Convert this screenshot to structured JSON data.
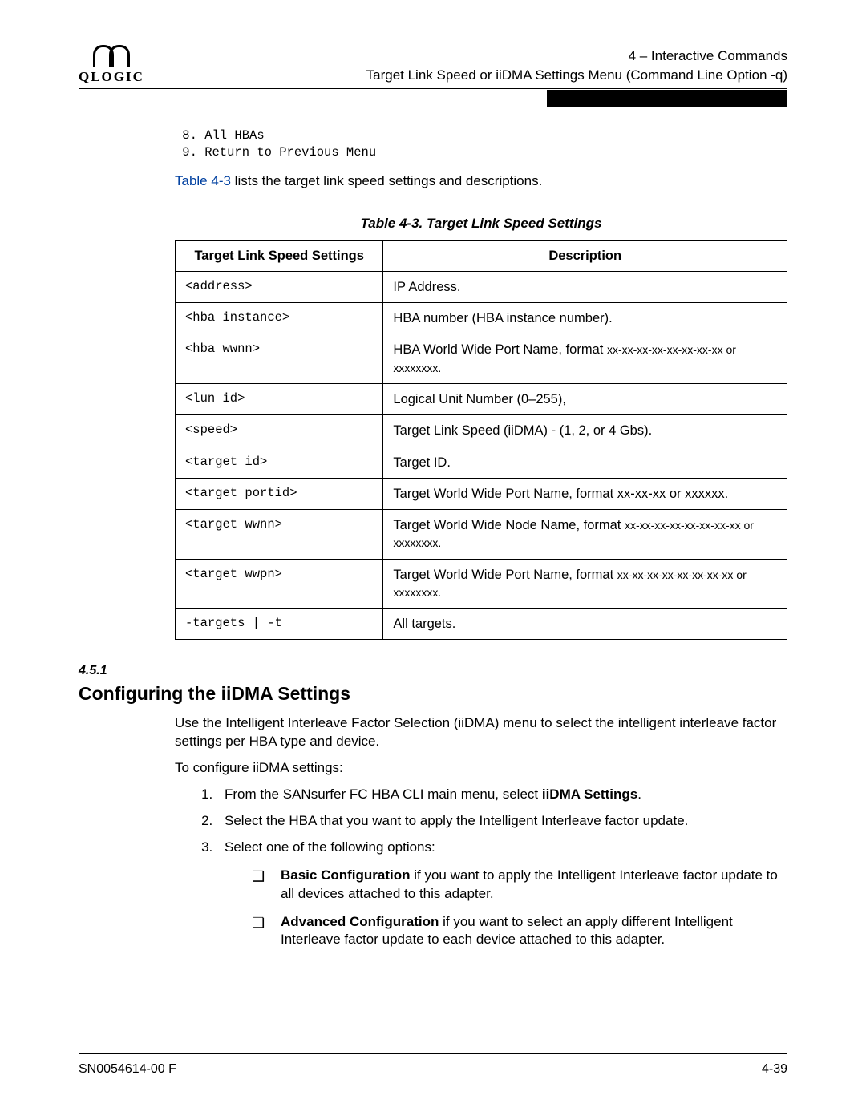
{
  "header": {
    "logo_text": "QLOGIC",
    "line1": "4 – Interactive Commands",
    "line2": "Target Link Speed or iiDMA Settings Menu (Command Line Option -q)"
  },
  "menu_lines": " 8. All HBAs\n 9. Return to Previous Menu",
  "intro_link": "Table 4-3",
  "intro_rest": " lists the target link speed settings and descriptions.",
  "table_title": "Table 4-3. Target Link Speed Settings",
  "table_headers": {
    "c1": "Target Link Speed Settings",
    "c2": "Description"
  },
  "rows": [
    {
      "c": "<address>",
      "d": "IP Address."
    },
    {
      "c": "<hba instance>",
      "d": "HBA number (HBA instance number)."
    },
    {
      "c": "<hba wwnn>",
      "d": "HBA World Wide Port Name, format ",
      "sub": "xx-xx-xx-xx-xx-xx-xx-xx or xxxxxxxx."
    },
    {
      "c": "<lun id>",
      "d": "Logical Unit Number (0–255),"
    },
    {
      "c": "<speed>",
      "d": "Target Link Speed (iiDMA) - (1, 2, or 4 Gbs)."
    },
    {
      "c": "<target id>",
      "d": "Target ID."
    },
    {
      "c": "<target portid>",
      "d": "Target World Wide Port Name, format xx-xx-xx or xxxxxx."
    },
    {
      "c": "<target wwnn>",
      "d": "Target World Wide Node Name, format ",
      "sub": "xx-xx-xx-xx-xx-xx-xx-xx or xxxxxxxx."
    },
    {
      "c": "<target wwpn>",
      "d": "Target World Wide Port Name, format ",
      "sub": "xx-xx-xx-xx-xx-xx-xx-xx or xxxxxxxx."
    },
    {
      "c": "-targets | -t",
      "d": "All targets."
    }
  ],
  "section": {
    "num": "4.5.1",
    "title": "Configuring the iiDMA Settings",
    "p1": "Use the Intelligent Interleave Factor Selection (iiDMA) menu to select the intelligent interleave factor settings per HBA type and device.",
    "p2": "To configure iiDMA settings:",
    "step1a": "From the SANsurfer FC HBA CLI main menu, select ",
    "step1b": "iiDMA Settings",
    "step1c": ".",
    "step2": "Select the HBA that you want to apply the Intelligent Interleave factor update.",
    "step3": "Select one of the following options:",
    "opt1a": "Basic Configuration",
    "opt1b": " if you want to apply the Intelligent Interleave factor update to all devices attached to this adapter.",
    "opt2a": "Advanced Configuration",
    "opt2b": " if you want to select an apply different Intelligent Interleave factor update to each device attached to this adapter."
  },
  "footer": {
    "left": "SN0054614-00 F",
    "right": "4-39"
  }
}
